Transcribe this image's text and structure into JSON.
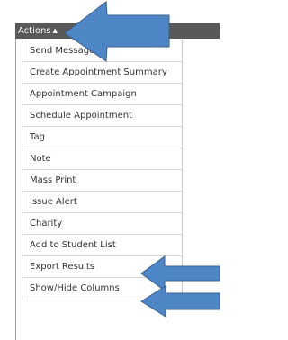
{
  "actions_label": "Actions",
  "menu": {
    "items": [
      "Send Message",
      "Create Appointment Summary",
      "Appointment Campaign",
      "Schedule Appointment",
      "Tag",
      "Note",
      "Mass Print",
      "Issue Alert",
      "Charity",
      "Add to Student List",
      "Export Results",
      "Show/Hide Columns"
    ]
  },
  "colors": {
    "header_bg": "#595959",
    "arrow_fill": "#4f86c6",
    "arrow_stroke": "#3a5f8f"
  }
}
